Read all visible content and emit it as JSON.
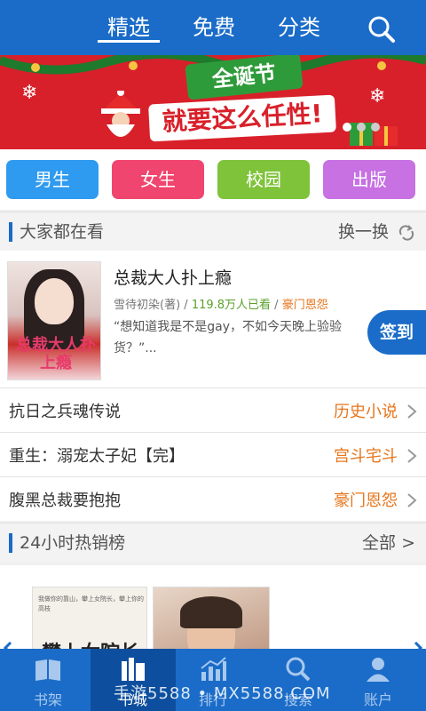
{
  "top_nav": {
    "tabs": [
      {
        "label": "精选",
        "active": true
      },
      {
        "label": "免费",
        "active": false
      },
      {
        "label": "分类",
        "active": false
      }
    ],
    "search_icon": "search-icon"
  },
  "banner": {
    "line1": "全诞节",
    "line2": "就要这么任性!"
  },
  "categories": [
    {
      "label": "男生",
      "color": "#2f9bf0"
    },
    {
      "label": "女生",
      "color": "#f0456e"
    },
    {
      "label": "校园",
      "color": "#7fc33b"
    },
    {
      "label": "出版",
      "color": "#c771e3"
    }
  ],
  "popular": {
    "title": "大家都在看",
    "action": "换一换",
    "featured": {
      "title": "总裁大人扑上瘾",
      "cover_text": "总裁大人扑上瘾",
      "author": "雪待初染(著)",
      "readers": "119.8万人已看",
      "genre": "豪门恩怨",
      "description": "“想知道我是不是gay，不如今天晚上验验货？”..."
    },
    "list": [
      {
        "name": "抗日之兵魂传说",
        "tag": "历史小说"
      },
      {
        "name": "重生：溺宠太子妃【完】",
        "tag": "宫斗宅斗"
      },
      {
        "name": "腹黑总裁要抱抱",
        "tag": "豪门恩怨"
      }
    ]
  },
  "sign_in": "签到",
  "hot": {
    "title": "24小时热销榜",
    "action": "全部 >",
    "cover1_title": "攀上女院长",
    "cover1_tagline": "我做你的靠山，攀上女院长，攀上你的高枝"
  },
  "bottom_nav": {
    "items": [
      {
        "label": "书架",
        "icon": "book-shelf-icon"
      },
      {
        "label": "书城",
        "icon": "book-store-icon",
        "active": true
      },
      {
        "label": "排行",
        "icon": "rank-chart-icon"
      },
      {
        "label": "搜索",
        "icon": "search-icon"
      },
      {
        "label": "账户",
        "icon": "user-icon"
      }
    ]
  },
  "watermark": "手游5588 • MX5588.COM",
  "colors": {
    "primary": "#1a6cc8",
    "accent_orange": "#e6761c",
    "readers_green": "#5aa02c"
  }
}
